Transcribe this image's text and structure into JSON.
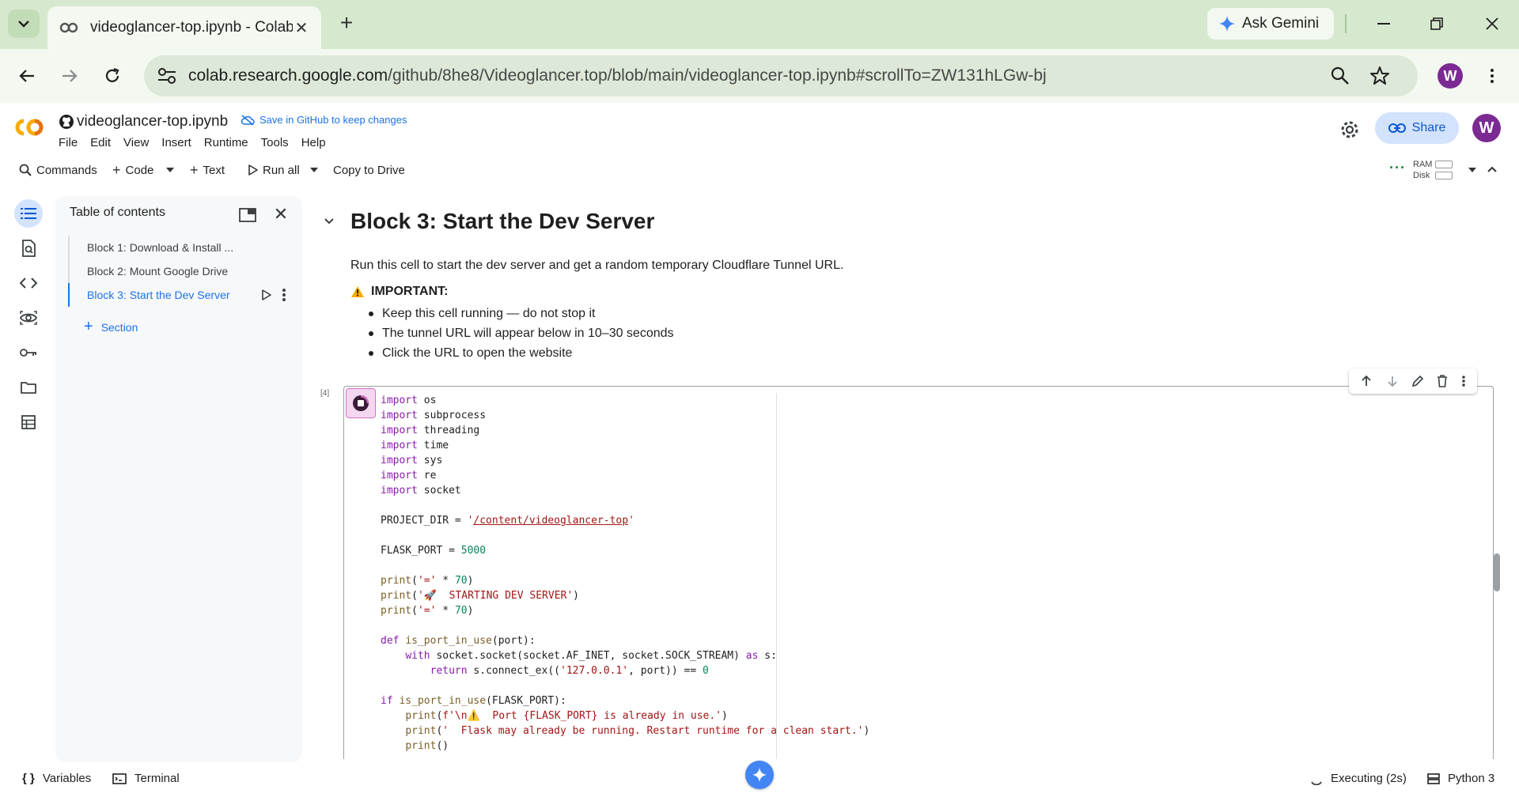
{
  "browser": {
    "tab_title": "videoglancer-top.ipynb - Colab",
    "ask_gemini": "Ask Gemini",
    "url_host": "colab.research.google.com",
    "url_rest": "/github/8he8/Videoglancer.top/blob/main/videoglancer-top.ipynb#scrollTo=ZW131hLGw-bj",
    "profile_initial": "W"
  },
  "colab": {
    "notebook_title": "videoglancer-top.ipynb",
    "save_github": "Save in GitHub to keep changes",
    "menu": [
      "File",
      "Edit",
      "View",
      "Insert",
      "Runtime",
      "Tools",
      "Help"
    ],
    "share_label": "Share",
    "account_initial": "W"
  },
  "toolbar": {
    "commands": "Commands",
    "code": "Code",
    "text": "Text",
    "run_all": "Run all",
    "copy_to_drive": "Copy to Drive",
    "ram_label": "RAM",
    "disk_label": "Disk"
  },
  "toc": {
    "title": "Table of contents",
    "items": [
      {
        "label": "Block 1: Download & Install ..."
      },
      {
        "label": "Block 2: Mount Google Drive"
      },
      {
        "label": "Block 3: Start the Dev Server"
      }
    ],
    "add_section": "Section"
  },
  "notebook": {
    "heading": "Block 3: Start the Dev Server",
    "paragraph": "Run this cell to start the dev server and get a random temporary Cloudflare Tunnel URL.",
    "important": "IMPORTANT:",
    "bullets": [
      "Keep this cell running — do not stop it",
      "The tunnel URL will appear below in 10–30 seconds",
      "Click the URL to open the website"
    ],
    "exec_count": "[4]"
  },
  "status": {
    "variables": "Variables",
    "terminal": "Terminal",
    "executing": "Executing (2s)",
    "runtime": "Python 3"
  },
  "colors": {
    "tab_bar": "#d6e9cf",
    "accent_blue": "#1a73e8",
    "avatar_purple": "#7b2a93",
    "keyword": "#8a1bad",
    "string": "#a31515"
  }
}
